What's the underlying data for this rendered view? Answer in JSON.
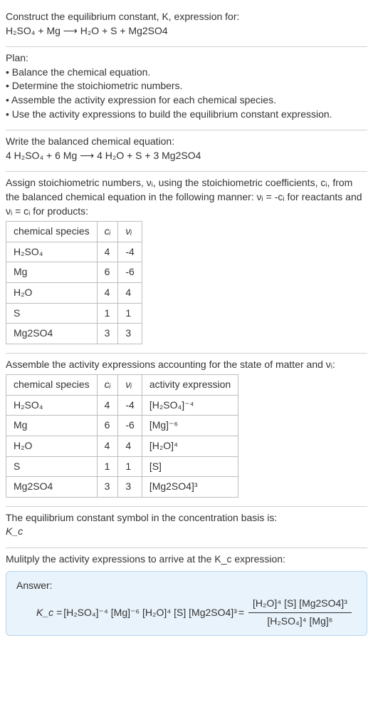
{
  "intro": {
    "line1": "Construct the equilibrium constant, K, expression for:",
    "equation": "H₂SO₄ + Mg ⟶ H₂O + S + Mg2SO4"
  },
  "plan": {
    "heading": "Plan:",
    "items": [
      "• Balance the chemical equation.",
      "• Determine the stoichiometric numbers.",
      "• Assemble the activity expression for each chemical species.",
      "• Use the activity expressions to build the equilibrium constant expression."
    ]
  },
  "balanced": {
    "heading": "Write the balanced chemical equation:",
    "equation": "4 H₂SO₄ + 6 Mg ⟶ 4 H₂O + S + 3 Mg2SO4"
  },
  "stoich": {
    "intro_a": "Assign stoichiometric numbers, νᵢ, using the stoichiometric coefficients, cᵢ, from the balanced chemical equation in the following manner: νᵢ = -cᵢ for reactants and νᵢ = cᵢ for products:",
    "headers": {
      "species": "chemical species",
      "ci": "cᵢ",
      "vi": "νᵢ"
    },
    "rows": [
      {
        "species": "H₂SO₄",
        "ci": "4",
        "vi": "-4"
      },
      {
        "species": "Mg",
        "ci": "6",
        "vi": "-6"
      },
      {
        "species": "H₂O",
        "ci": "4",
        "vi": "4"
      },
      {
        "species": "S",
        "ci": "1",
        "vi": "1"
      },
      {
        "species": "Mg2SO4",
        "ci": "3",
        "vi": "3"
      }
    ]
  },
  "activity": {
    "intro": "Assemble the activity expressions accounting for the state of matter and νᵢ:",
    "headers": {
      "species": "chemical species",
      "ci": "cᵢ",
      "vi": "νᵢ",
      "expr": "activity expression"
    },
    "rows": [
      {
        "species": "H₂SO₄",
        "ci": "4",
        "vi": "-4",
        "expr": "[H₂SO₄]⁻⁴"
      },
      {
        "species": "Mg",
        "ci": "6",
        "vi": "-6",
        "expr": "[Mg]⁻⁶"
      },
      {
        "species": "H₂O",
        "ci": "4",
        "vi": "4",
        "expr": "[H₂O]⁴"
      },
      {
        "species": "S",
        "ci": "1",
        "vi": "1",
        "expr": "[S]"
      },
      {
        "species": "Mg2SO4",
        "ci": "3",
        "vi": "3",
        "expr": "[Mg2SO4]³"
      }
    ]
  },
  "ksymbol": {
    "line1": "The equilibrium constant symbol in the concentration basis is:",
    "symbol": "K_c"
  },
  "final": {
    "intro": "Mulitply the activity expressions to arrive at the K_c expression:",
    "answer_label": "Answer:",
    "kc_label": "K_c = ",
    "product_form": "[H₂SO₄]⁻⁴ [Mg]⁻⁶ [H₂O]⁴ [S] [Mg2SO4]³",
    "equals": " = ",
    "numerator": "[H₂O]⁴ [S] [Mg2SO4]³",
    "denominator": "[H₂SO₄]⁴ [Mg]⁶"
  }
}
